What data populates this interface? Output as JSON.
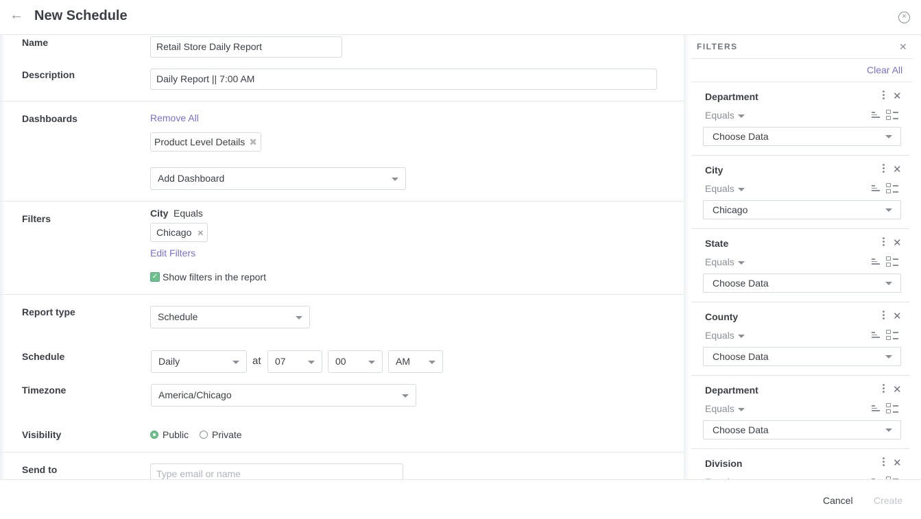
{
  "header": {
    "back_icon": "arrow-left-icon",
    "title": "New Schedule",
    "close_icon": "close-circle-icon"
  },
  "form": {
    "name": {
      "label": "Name",
      "value": "Retail Store Daily Report"
    },
    "description": {
      "label": "Description",
      "value": "Daily Report || 7:00 AM"
    },
    "dashboards": {
      "label": "Dashboards",
      "remove_all": "Remove All",
      "chips": [
        {
          "label": "Product Level Details"
        }
      ],
      "add_placeholder": "Add Dashboard"
    },
    "filters": {
      "label": "Filters",
      "field": "City",
      "operator": "Equals",
      "chips": [
        {
          "label": "Chicago"
        }
      ],
      "edit_link": "Edit Filters",
      "show_in_report_label": "Show filters in the report",
      "show_in_report_checked": true
    },
    "report_type": {
      "label": "Report type",
      "value": "Schedule"
    },
    "schedule": {
      "label": "Schedule",
      "frequency": "Daily",
      "at_label": "at",
      "hour": "07",
      "minute": "00",
      "meridiem": "AM"
    },
    "timezone": {
      "label": "Timezone",
      "value": "America/Chicago"
    },
    "visibility": {
      "label": "Visibility",
      "options": [
        {
          "label": "Public",
          "selected": true
        },
        {
          "label": "Private",
          "selected": false
        }
      ]
    },
    "send_to": {
      "label": "Send to",
      "placeholder": "Type email or name"
    }
  },
  "filters_panel": {
    "title": "FILTERS",
    "clear_all": "Clear All",
    "items": [
      {
        "name": "Department",
        "operator": "Equals",
        "value": "Choose Data"
      },
      {
        "name": "City",
        "operator": "Equals",
        "value": "Chicago"
      },
      {
        "name": "State",
        "operator": "Equals",
        "value": "Choose Data"
      },
      {
        "name": "County",
        "operator": "Equals",
        "value": "Choose Data"
      },
      {
        "name": "Department",
        "operator": "Equals",
        "value": "Choose Data"
      },
      {
        "name": "Division",
        "operator": "Equals",
        "value": ""
      }
    ]
  },
  "footer": {
    "cancel": "Cancel",
    "create": "Create"
  },
  "colors": {
    "accent_link": "#7a6fd0",
    "success_green": "#6cc18d",
    "disabled_text": "#c2c6ca"
  }
}
